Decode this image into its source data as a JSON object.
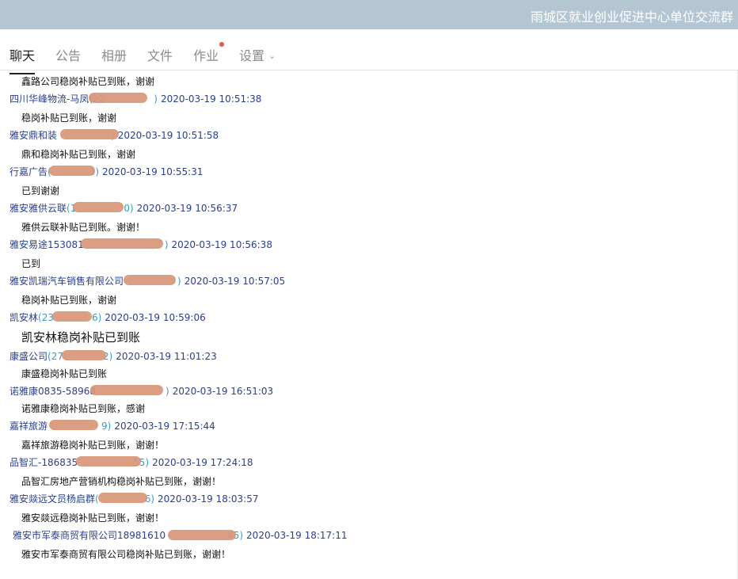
{
  "window": {
    "title": "雨城区就业创业促进中心单位交流群"
  },
  "tabs": [
    {
      "label": "聊天",
      "active": true
    },
    {
      "label": "公告"
    },
    {
      "label": "相册"
    },
    {
      "label": "文件"
    },
    {
      "label": "作业",
      "badge_dot": true
    },
    {
      "label": "设置",
      "has_dropdown": true
    }
  ],
  "colors": {
    "title_bar": "#b5c6d3",
    "sender": "#2a3f8f",
    "redaction": "#d99677",
    "badge": "#e0574a"
  },
  "messages": [
    {
      "text": "鑫路公司稳岗补贴已到账，谢谢"
    },
    {
      "sender": "四川华峰物流-马凤",
      "account": "(22",
      "account_tail": ")",
      "time": "2020-03-19 10:51:38",
      "text": "稳岗补贴已到账，谢谢"
    },
    {
      "sender": "雅安鼎和装",
      "account": "",
      "account_tail": ")",
      "time": "2020-03-19 10:51:58",
      "text": "鼎和稳岗补贴已到账，谢谢"
    },
    {
      "sender": "行嘉广告",
      "account": "(",
      "account_tail": "3)",
      "time": "2020-03-19 10:55:31",
      "text": "已到谢谢"
    },
    {
      "sender": "雅安雅供云联",
      "account": "(1",
      "account_tail": "0)",
      "time": "2020-03-19 10:56:37",
      "text": "雅供云联补贴已到账。谢谢！"
    },
    {
      "sender": "雅安易途153081",
      "account": "",
      "account_tail": ")",
      "time": "2020-03-19 10:56:38",
      "text": "已到"
    },
    {
      "sender": "雅安凯瑞汽车销售有限公司",
      "account": "",
      "account_tail": ")",
      "time": "2020-03-19 10:57:05",
      "text": "稳岗补贴已到账，谢谢"
    },
    {
      "sender": "凯安林",
      "account": "(23",
      "account_tail": "6)",
      "time": "2020-03-19 10:59:06",
      "text": "凯安林稳岗补贴已到账",
      "big": true
    },
    {
      "sender": "康盛公司",
      "account": "(27",
      "account_tail": "2)",
      "time": "2020-03-19 11:01:23",
      "text": "康盛稳岗补贴已到账"
    },
    {
      "sender": "诺雅康0835-58968",
      "account": "",
      "account_tail": ")",
      "time": "2020-03-19 16:51:03",
      "text": "诺雅康稳岗补贴已到账，感谢"
    },
    {
      "sender": "嘉祥旅游",
      "account": "",
      "account_tail": "9)",
      "time": "2020-03-19 17:15:44",
      "text": "嘉祥旅游稳岗补贴已到账，谢谢！"
    },
    {
      "sender": "品智汇-186835",
      "account": "",
      "account_tail": "55)",
      "time": "2020-03-19 17:24:18",
      "text": "品智汇房地产营销机构稳岗补贴已到账，谢谢！"
    },
    {
      "sender": "雅安燚远文员杨启群",
      "account": "(",
      "account_tail": "6)",
      "time": "2020-03-19 18:03:57",
      "text": "雅安燚远稳岗补贴已到账，谢谢！"
    },
    {
      "sender": "雅安市军泰商贸有限公司18981610",
      "account": "",
      "account_tail": "45)",
      "time": "2020-03-19 18:17:11",
      "text": "雅安市军泰商贸有限公司稳岗补贴已到账，谢谢！"
    }
  ]
}
